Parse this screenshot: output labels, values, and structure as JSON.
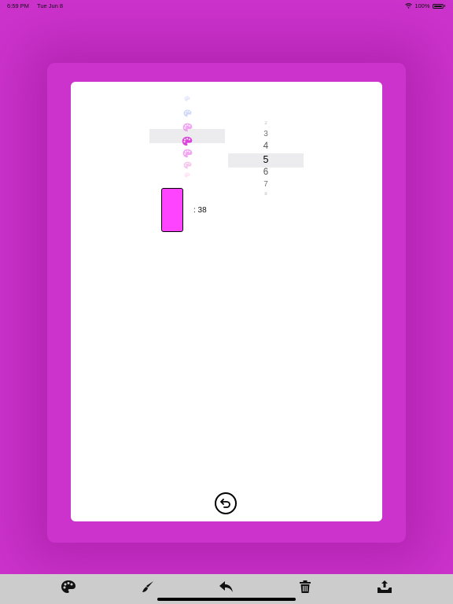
{
  "status_bar": {
    "time": "6:59 PM",
    "date": "Tue Jun 8",
    "battery": "100%"
  },
  "palette_picker": {
    "selected_color": "#dd44dd",
    "items": [
      {
        "color": "#aabbee",
        "opacity": 0.35
      },
      {
        "color": "#aabbee",
        "opacity": 0.55
      },
      {
        "color": "#ee88ee",
        "opacity": 0.75
      },
      {
        "color": "#dd44dd",
        "opacity": 1.0
      },
      {
        "color": "#ee88ee",
        "opacity": 0.75
      },
      {
        "color": "#ee99dd",
        "opacity": 0.55
      },
      {
        "color": "#ffaadd",
        "opacity": 0.35
      }
    ]
  },
  "number_picker": {
    "items": [
      "2",
      "3",
      "4",
      "5",
      "6",
      "7",
      "8"
    ],
    "selected": "5"
  },
  "swatch": {
    "color": "#ff44ff",
    "label": ": 38"
  },
  "toolbar": {
    "tools": [
      "palette-icon",
      "brush-icon",
      "undo-icon",
      "trash-icon",
      "export-icon"
    ]
  },
  "colors": {
    "background": "#cc33cc",
    "card": "#ffffff",
    "toolbar": "#cccccc"
  }
}
